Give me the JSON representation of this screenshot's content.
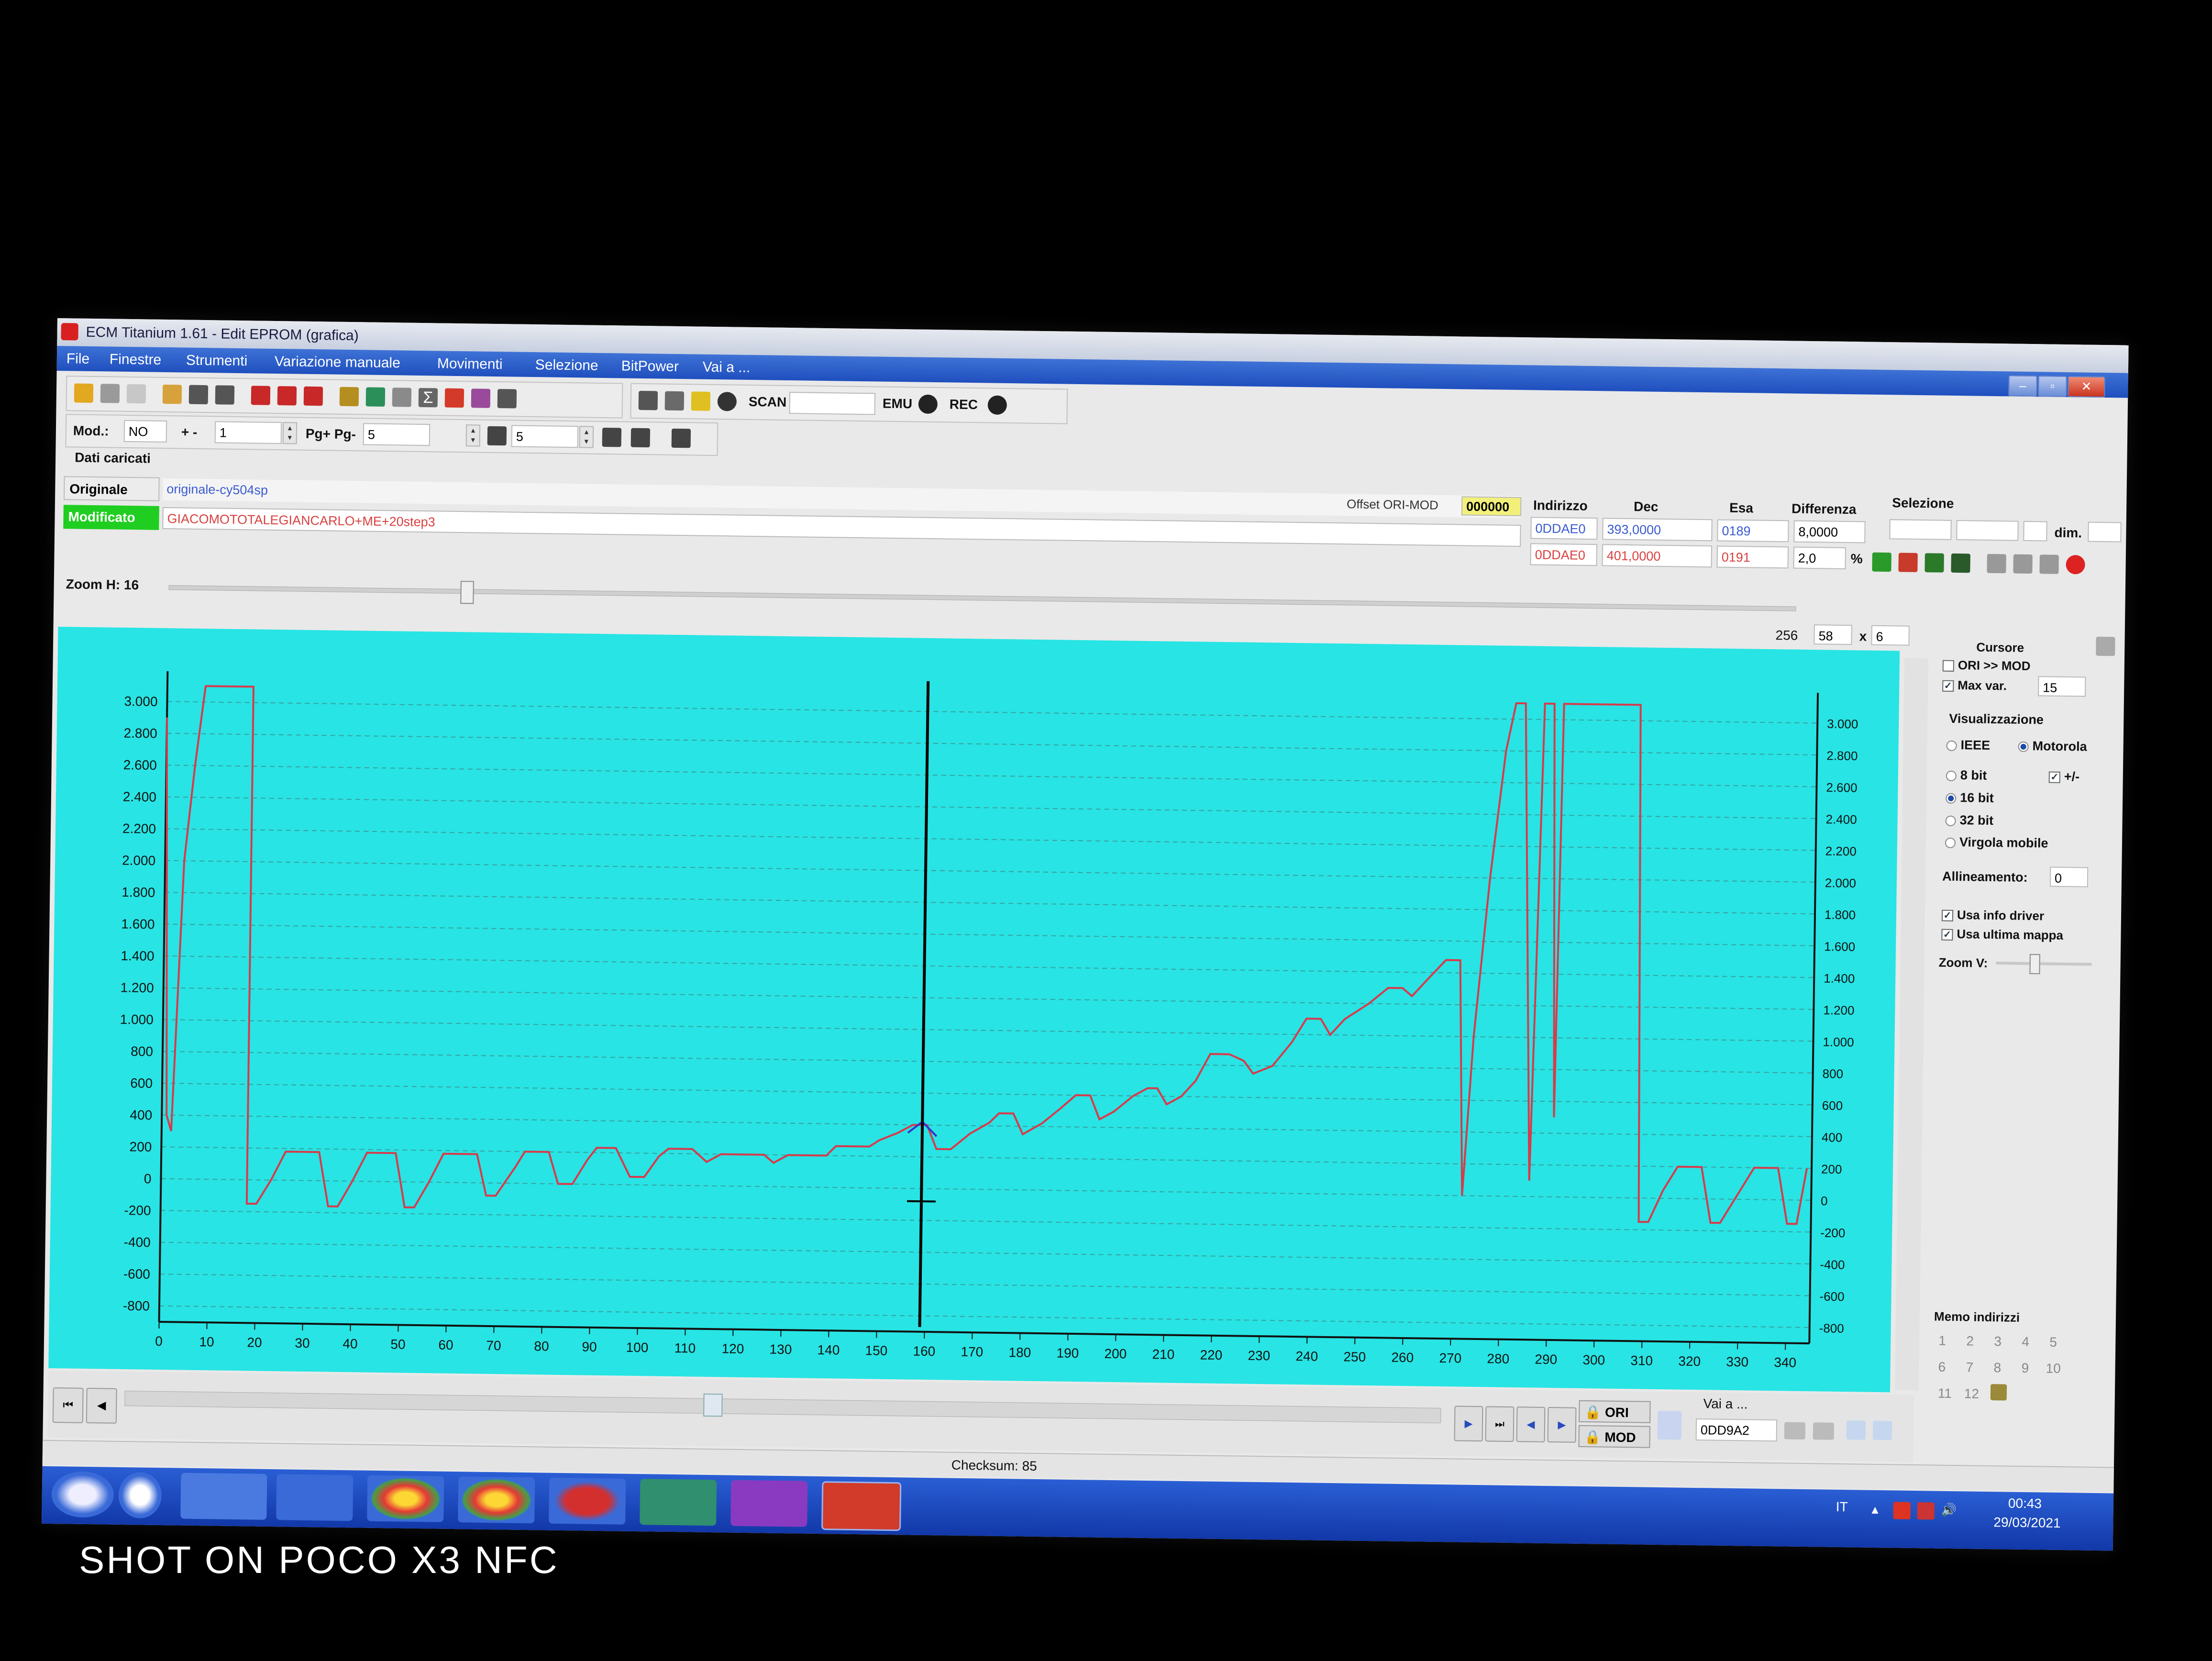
{
  "window": {
    "title": "ECM Titanium 1.61 - Edit EPROM (grafica)",
    "minimize": "–",
    "maximize": "▫",
    "close": "✕"
  },
  "menu": [
    "File",
    "Finestre",
    "Strumenti",
    "Variazione manuale",
    "Movimenti",
    "Selezione",
    "BitPower",
    "Vai a ..."
  ],
  "toolbar": {
    "scan": "SCAN",
    "emu": "EMU",
    "rec": "REC",
    "mod_label": "Mod.:",
    "mod_value": "NO",
    "plusminus_label": "+ -",
    "plusminus_value": "1",
    "pg_label": "Pg+ Pg-",
    "pg_value": "5",
    "step_value": "5"
  },
  "dati": {
    "heading": "Dati caricati",
    "originale_label": "Originale",
    "originale_file": "originale-cy504sp",
    "modificato_label": "Modificato",
    "modificato_file": "GIACOMOTOTALEGIANCARLO+ME+20step3",
    "offset_label": "Offset ORI-MOD",
    "offset_value": "000000"
  },
  "table": {
    "headers": [
      "Indirizzo",
      "Dec",
      "Esa",
      "Differenza"
    ],
    "ori": {
      "indirizzo": "0DDAE0",
      "dec": "393,0000",
      "esa": "0189",
      "diff": "8,0000"
    },
    "mod": {
      "indirizzo": "0DDAE0",
      "dec": "401,0000",
      "esa": "0191",
      "diff": "2,0"
    },
    "percent": "%"
  },
  "selezione": {
    "label": "Selezione",
    "dim": "dim."
  },
  "zoom": {
    "label": "Zoom H: 16",
    "v1": "256",
    "v2": "58",
    "x": "x",
    "v3": "6"
  },
  "side": {
    "cursore": "Cursore",
    "ori_mod": "ORI >> MOD",
    "max_var": "Max var.",
    "max_var_value": "15",
    "visualizzazione": "Visualizzazione",
    "ieee": "IEEE",
    "motorola": "Motorola",
    "bit8": "8 bit",
    "plusminus": "+/-",
    "bit16": "16 bit",
    "bit32": "32 bit",
    "virgola": "Virgola mobile",
    "allineamento": "Allineamento:",
    "allineamento_value": "0",
    "usa_info": "Usa info driver",
    "usa_ultima": "Usa ultima mappa",
    "zoom_v": "Zoom V:",
    "memo": "Memo indirizzi",
    "memo_nums": [
      "1",
      "2",
      "3",
      "4",
      "5",
      "6",
      "7",
      "8",
      "9",
      "10",
      "11",
      "12"
    ]
  },
  "bottom": {
    "ori": "ORI",
    "mod": "MOD",
    "vai_a": "Vai a ...",
    "vai_value": "0DD9A2",
    "checksum": "Checksum: 85"
  },
  "taskbar": {
    "lang": "IT",
    "time": "00:43",
    "date": "29/03/2021"
  },
  "watermark": "SHOT ON POCO X3 NFC",
  "chart_data": {
    "type": "line",
    "x_ticks": [
      0,
      10,
      20,
      30,
      40,
      50,
      60,
      70,
      80,
      90,
      100,
      110,
      120,
      130,
      140,
      150,
      160,
      170,
      180,
      190,
      200,
      210,
      220,
      230,
      240,
      250,
      260,
      270,
      280,
      290,
      300,
      310,
      320,
      330,
      340
    ],
    "y_ticks_left": [
      "3.000",
      "2.800",
      "2.600",
      "2.400",
      "2.200",
      "2.000",
      "1.800",
      "1.600",
      "1.400",
      "1.200",
      "1.000",
      "800",
      "600",
      "400",
      "200",
      "0",
      "-200",
      "-400",
      "-600",
      "-800"
    ],
    "y_ticks_right": [
      "3.000",
      "2.800",
      "2.600",
      "2.400",
      "2.200",
      "2.000",
      "1.800",
      "1.600",
      "1.400",
      "1.200",
      "1.000",
      "800",
      "600",
      "400",
      "200",
      "0",
      "-200",
      "-400",
      "-600",
      "-800"
    ],
    "xlim": [
      0,
      345
    ],
    "ylim": [
      -900,
      3100
    ],
    "cursor_x": 159,
    "series": [
      {
        "color": "#d83a4a",
        "points": [
          [
            0,
            2900
          ],
          [
            1,
            400
          ],
          [
            2,
            300
          ],
          [
            4,
            2000
          ],
          [
            6,
            2600
          ],
          [
            8,
            3100
          ],
          [
            18,
            3100
          ],
          [
            18,
            -150
          ],
          [
            20,
            -150
          ],
          [
            23,
            0
          ],
          [
            26,
            180
          ],
          [
            33,
            180
          ],
          [
            35,
            -160
          ],
          [
            37,
            -160
          ],
          [
            40,
            0
          ],
          [
            43,
            180
          ],
          [
            49,
            180
          ],
          [
            51,
            -160
          ],
          [
            53,
            -160
          ],
          [
            56,
            0
          ],
          [
            59,
            180
          ],
          [
            66,
            180
          ],
          [
            68,
            -80
          ],
          [
            70,
            -80
          ],
          [
            74,
            100
          ],
          [
            76,
            200
          ],
          [
            81,
            200
          ],
          [
            83,
            0
          ],
          [
            86,
            0
          ],
          [
            89,
            150
          ],
          [
            91,
            230
          ],
          [
            95,
            230
          ],
          [
            98,
            50
          ],
          [
            101,
            50
          ],
          [
            104,
            180
          ],
          [
            106,
            230
          ],
          [
            111,
            230
          ],
          [
            114,
            150
          ],
          [
            117,
            200
          ],
          [
            126,
            200
          ],
          [
            128,
            150
          ],
          [
            131,
            200
          ],
          [
            139,
            200
          ],
          [
            141,
            260
          ],
          [
            148,
            260
          ],
          [
            150,
            300
          ],
          [
            154,
            350
          ],
          [
            157,
            400
          ],
          [
            160,
            400
          ],
          [
            162,
            250
          ],
          [
            165,
            250
          ],
          [
            169,
            350
          ],
          [
            173,
            420
          ],
          [
            175,
            480
          ],
          [
            178,
            480
          ],
          [
            180,
            350
          ],
          [
            184,
            420
          ],
          [
            188,
            520
          ],
          [
            191,
            600
          ],
          [
            194,
            600
          ],
          [
            196,
            450
          ],
          [
            199,
            500
          ],
          [
            203,
            600
          ],
          [
            206,
            650
          ],
          [
            208,
            650
          ],
          [
            210,
            550
          ],
          [
            213,
            600
          ],
          [
            216,
            700
          ],
          [
            219,
            870
          ],
          [
            223,
            870
          ],
          [
            226,
            830
          ],
          [
            228,
            750
          ],
          [
            232,
            800
          ],
          [
            236,
            950
          ],
          [
            239,
            1100
          ],
          [
            242,
            1100
          ],
          [
            244,
            1000
          ],
          [
            247,
            1100
          ],
          [
            252,
            1200
          ],
          [
            256,
            1300
          ],
          [
            259,
            1300
          ],
          [
            261,
            1250
          ],
          [
            264,
            1350
          ],
          [
            268,
            1480
          ],
          [
            271,
            1480
          ],
          [
            272,
            0
          ],
          [
            274,
            1000
          ],
          [
            277,
            2000
          ],
          [
            280,
            2800
          ],
          [
            282,
            3100
          ],
          [
            284,
            3100
          ],
          [
            286,
            100
          ],
          [
            288,
            3100
          ],
          [
            290,
            3100
          ],
          [
            291,
            500
          ],
          [
            292,
            3100
          ],
          [
            308,
            3100
          ],
          [
            309,
            -150
          ],
          [
            311,
            -150
          ],
          [
            314,
            50
          ],
          [
            317,
            200
          ],
          [
            322,
            200
          ],
          [
            324,
            -150
          ],
          [
            326,
            -150
          ],
          [
            330,
            50
          ],
          [
            333,
            200
          ],
          [
            338,
            200
          ],
          [
            340,
            -150
          ],
          [
            342,
            -150
          ],
          [
            344,
            200
          ]
        ]
      },
      {
        "color": "#3333cc",
        "points": [
          [
            156,
            350
          ],
          [
            159,
            420
          ],
          [
            162,
            330
          ]
        ]
      }
    ]
  }
}
